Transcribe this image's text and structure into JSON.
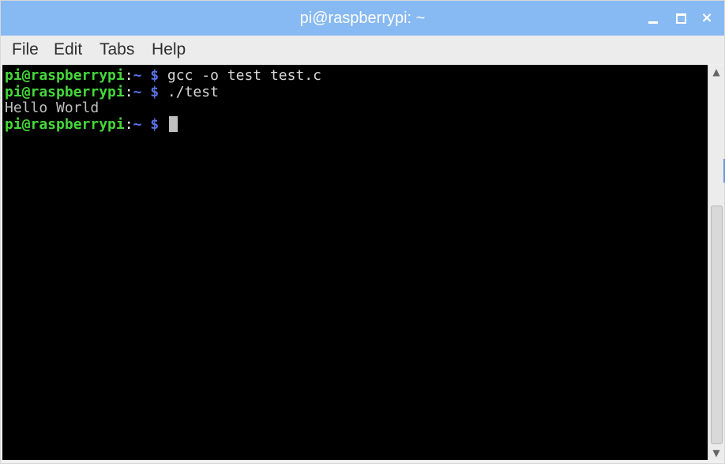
{
  "window": {
    "title": "pi@raspberrypi: ~",
    "controls": {
      "minimize_icon": "minimize-icon",
      "maximize_icon": "maximize-icon",
      "close_icon": "close-icon",
      "close_glyph": "×"
    },
    "titlebar_color": "#87b9f2"
  },
  "menu": {
    "items": [
      {
        "label": "File"
      },
      {
        "label": "Edit"
      },
      {
        "label": "Tabs"
      },
      {
        "label": "Help"
      }
    ]
  },
  "terminal": {
    "lines": [
      {
        "user": "pi@raspberrypi",
        "sep": ":",
        "path": "~ $",
        "command": " gcc -o test test.c"
      },
      {
        "user": "pi@raspberrypi",
        "sep": ":",
        "path": "~ $",
        "command": " ./test"
      },
      {
        "output": "Hello World"
      },
      {
        "user": "pi@raspberrypi",
        "sep": ":",
        "path": "~ $",
        "command": " "
      }
    ],
    "colors": {
      "background": "#000000",
      "prompt_user": "#45d83a",
      "prompt_path": "#5a73e8",
      "text": "#d8d8d8"
    }
  },
  "scrollbar": {
    "up_arrow": "▲",
    "down_arrow": "▼"
  }
}
